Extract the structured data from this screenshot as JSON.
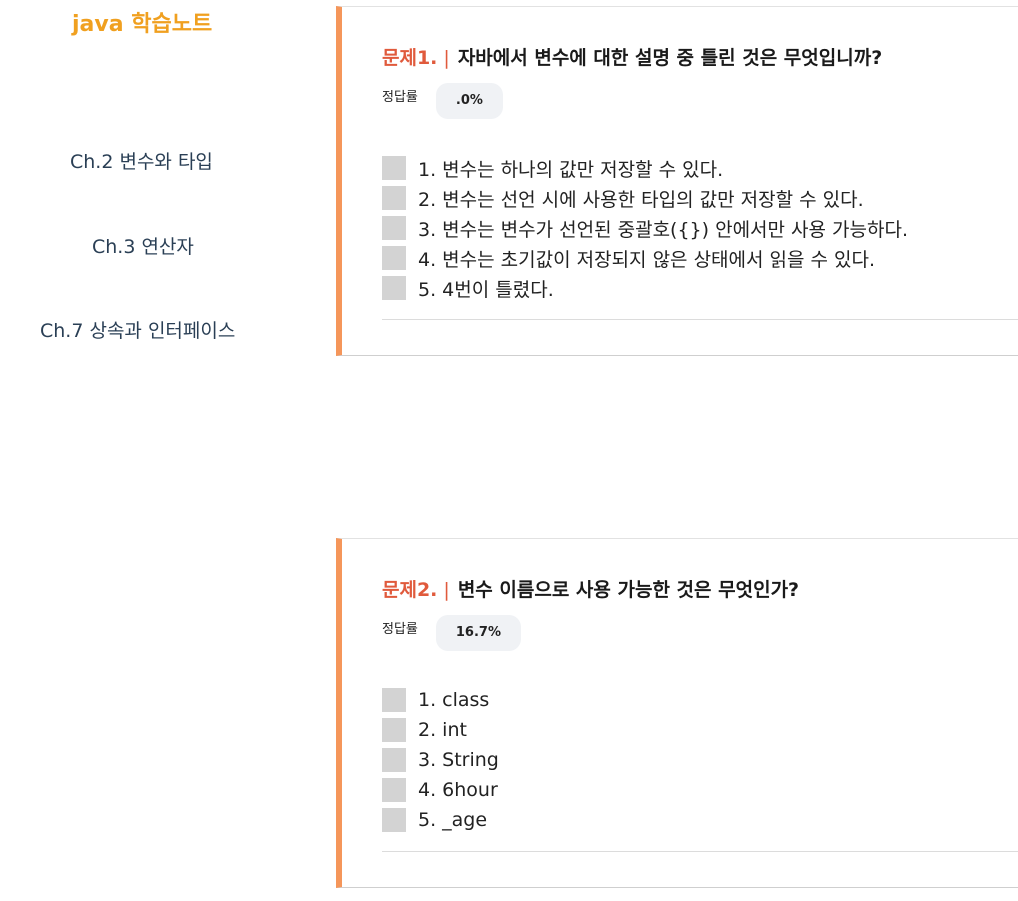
{
  "sidebar": {
    "brand": "java 학습노트",
    "items": [
      {
        "label": "Ch.2 변수와 타입"
      },
      {
        "label": "Ch.3 연산자"
      },
      {
        "label": "Ch.7 상속과 인터페이스"
      }
    ]
  },
  "questions": [
    {
      "number": "문제1.",
      "separator": "|",
      "title": "자바에서 변수에 대한 설명 중 틀린 것은 무엇입니까?",
      "rate_label": "정답률",
      "rate_value": ".0%",
      "options": [
        "1. 변수는 하나의 값만 저장할 수 있다.",
        "2. 변수는 선언 시에 사용한 타입의 값만 저장할 수 있다.",
        "3. 변수는 변수가 선언된 중괄호({}) 안에서만 사용 가능하다.",
        "4. 변수는 초기값이 저장되지 않은 상태에서 읽을 수 있다.",
        "5. 4번이 틀렸다."
      ]
    },
    {
      "number": "문제2.",
      "separator": "|",
      "title": "변수 이름으로 사용 가능한 것은 무엇인가?",
      "rate_label": "정답률",
      "rate_value": "16.7%",
      "options": [
        "1. class",
        "2. int",
        "3. String",
        "4. 6hour",
        "5. _age"
      ]
    }
  ],
  "colors": {
    "brand": "#f0a020",
    "accent_border": "#f5965a",
    "question_number": "#e05a3c",
    "nav_text": "#2a3f55",
    "checkbox": "#d3d3d3",
    "badge_bg": "#f0f2f5"
  }
}
